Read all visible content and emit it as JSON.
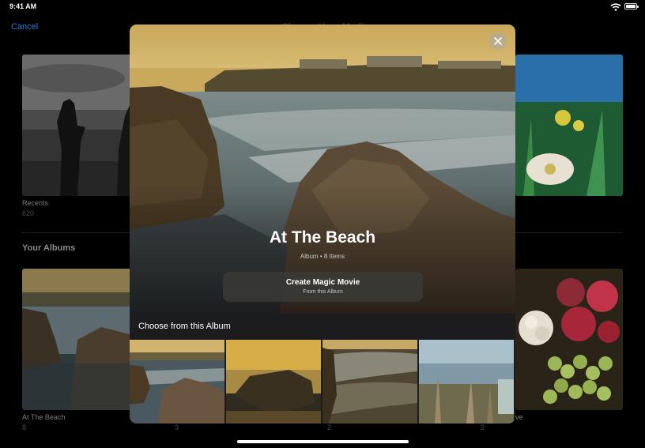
{
  "status_bar": {
    "time": "9:41 AM"
  },
  "header": {
    "cancel_label": "Cancel",
    "title": "Choose Your Media"
  },
  "library": {
    "recents": {
      "label": "Recents",
      "count": "620"
    },
    "section_title": "Your Albums",
    "albums": [
      {
        "label": "At The Beach",
        "count": "8"
      },
      {
        "label": "",
        "count": "3"
      },
      {
        "label": "",
        "count": "2"
      },
      {
        "label": "ve",
        "count": "2"
      }
    ]
  },
  "modal": {
    "title": "At The Beach",
    "subtitle": "Album • 8 Items",
    "magic_movie": {
      "title": "Create Magic Movie",
      "subtitle": "From this Album"
    },
    "choose_label": "Choose from this Album"
  },
  "icons": {
    "close": "close-icon",
    "wifi": "wifi-icon",
    "battery": "battery-icon"
  },
  "colors": {
    "accent": "#2f7bd6",
    "modal_bg": "#1c1c1e"
  }
}
